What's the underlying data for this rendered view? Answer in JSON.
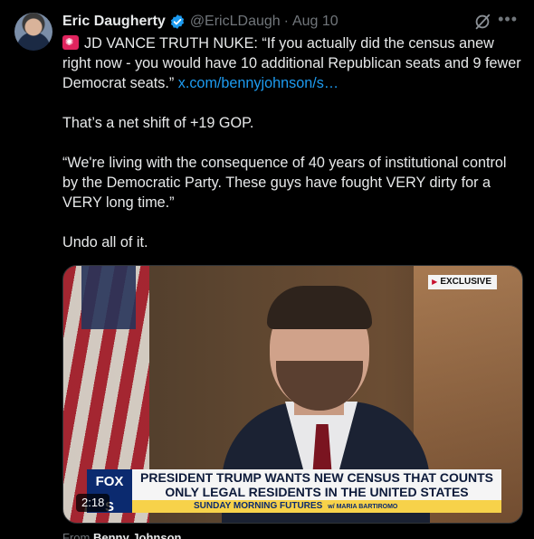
{
  "tweet": {
    "author_name": "Eric Daugherty",
    "handle": "@EricLDaugh",
    "separator": "·",
    "date": "Aug 10",
    "more": "•••",
    "line1_prefix": "JD VANCE TRUTH NUKE: “If you actually did the census anew right now - you would have 10 additional Republican seats and 9 fewer Democrat seats.”",
    "link": "x.com/bennyjohnson/s…",
    "para2": "That’s a net shift of +19 GOP.",
    "para3": "“We're living with the consequence of 40 years of institutional control by the Democratic Party. These guys have fought VERY dirty for a VERY long time.”",
    "para4": "Undo all of it."
  },
  "video": {
    "badge": "EXCLUSIVE",
    "logo_top": "FOX",
    "logo_bottom": "S",
    "headline_line1": "PRESIDENT TRUMP WANTS NEW CENSUS THAT COUNTS",
    "headline_line2": "ONLY LEGAL RESIDENTS IN THE UNITED STATES",
    "show_name": "SUNDAY MORNING FUTURES",
    "host": "w/ MARIA BARTIROMO",
    "duration": "2:18"
  },
  "attribution": {
    "from_label": "From",
    "source_name": "Benny Johnson"
  },
  "colors": {
    "background": "#000000",
    "link": "#1d9bf0",
    "verified": "#1d9bf0",
    "muted": "#71767b"
  }
}
